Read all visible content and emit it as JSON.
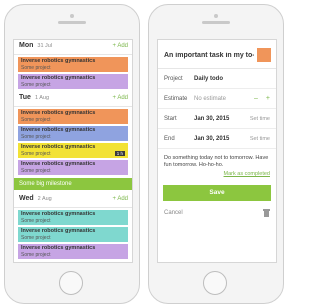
{
  "left": {
    "days": [
      {
        "name": "Mon",
        "date": "31 Jul",
        "add": "+ Add",
        "tasks": [
          {
            "title": "Inverse robotics gymnastics",
            "project": "Some project",
            "color": "#f0955a"
          },
          {
            "title": "Inverse robotics gymnastics",
            "project": "Some project",
            "color": "#c6a4e4"
          }
        ]
      },
      {
        "name": "Tue",
        "date": "1 Aug",
        "add": "+ Add",
        "tasks": [
          {
            "title": "Inverse robotics gymnastics",
            "project": "Some project",
            "color": "#f0955a"
          },
          {
            "title": "Inverse robotics gymnastics",
            "project": "Some project",
            "color": "#8fa3e0"
          },
          {
            "title": "Inverse robotics gymnastics",
            "project": "Some project",
            "color": "#f2e235",
            "tag": "1 h"
          },
          {
            "title": "Inverse robotics gymnastics",
            "project": "Some project",
            "color": "#c6a4e4"
          }
        ],
        "milestone": "Some big milestone"
      },
      {
        "name": "Wed",
        "date": "2 Aug",
        "add": "+ Add",
        "tasks": [
          {
            "title": "Inverse robotics gymnastics",
            "project": "Some project",
            "color": "#7fd8cf"
          },
          {
            "title": "Inverse robotics gymnastics",
            "project": "Some project",
            "color": "#7fd8cf"
          },
          {
            "title": "Inverse robotics gymnastics",
            "project": "Some project",
            "color": "#c6a4e4"
          }
        ]
      }
    ]
  },
  "right": {
    "title": "An important task in my to-d...",
    "swatch_color": "#f0955a",
    "project": {
      "label": "Project",
      "value": "Daily todo"
    },
    "estimate": {
      "label": "Estimate",
      "value": "No estimate",
      "minus": "–",
      "plus": "+"
    },
    "start": {
      "label": "Start",
      "value": "Jan 30, 2015",
      "aux": "Set time"
    },
    "end": {
      "label": "End",
      "value": "Jan 30, 2015",
      "aux": "Set time"
    },
    "note": "Do something today not to tomorrow. Have fun tomorrow. Ho-ho-ho.",
    "mark_completed": "Mark as completed",
    "save": "Save",
    "cancel": "Cancel"
  },
  "colors": {
    "accent": "#8cc63f",
    "link": "#7ab648"
  }
}
